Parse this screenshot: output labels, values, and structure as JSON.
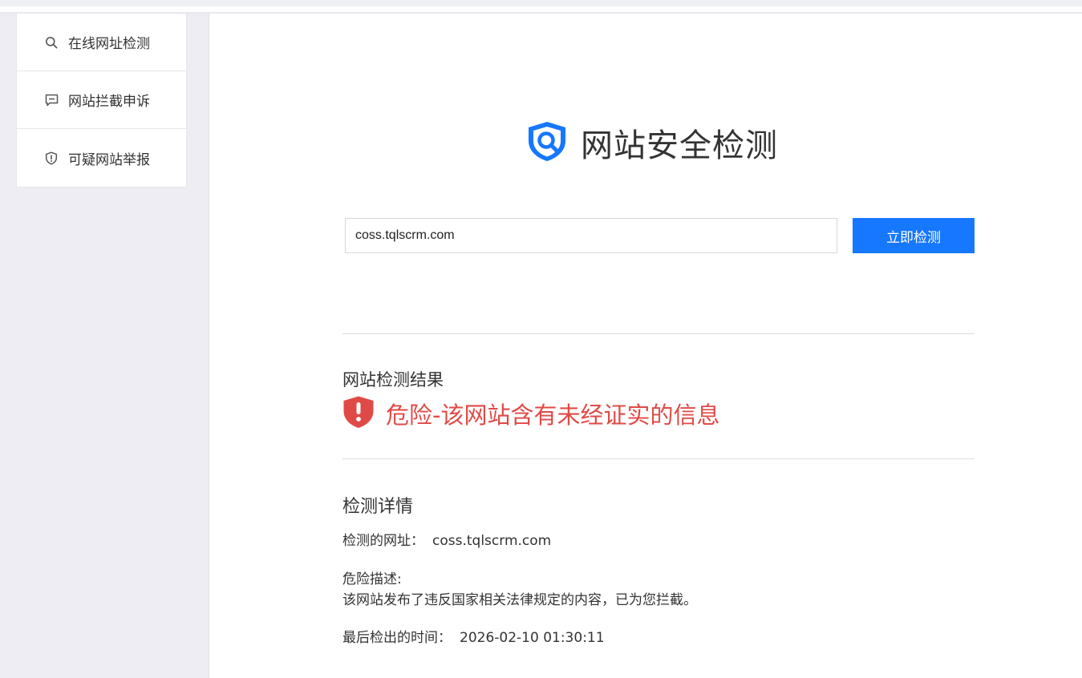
{
  "sidebar": {
    "items": [
      {
        "label": "在线网址检测",
        "icon": "search-icon"
      },
      {
        "label": "网站拦截申诉",
        "icon": "message-icon"
      },
      {
        "label": "可疑网站举报",
        "icon": "shield-alert-icon"
      }
    ]
  },
  "logo": {
    "title": "网站安全检测",
    "icon": "shield-search-icon"
  },
  "search": {
    "value": "coss.tqlscrm.com",
    "button_label": "立即检测"
  },
  "result": {
    "heading": "网站检测结果",
    "status": "危险-该网站含有未经证实的信息",
    "status_icon": "danger-shield-icon"
  },
  "details": {
    "heading": "检测详情",
    "url_label": "检测的网址：",
    "url_value": "coss.tqlscrm.com",
    "risk_label": "危险描述:",
    "risk_text": "该网站发布了违反国家相关法律规定的内容，已为您拦截。",
    "time_label": "最后检出的时间：",
    "time_value": "2026-02-10 01:30:11"
  },
  "colors": {
    "accent": "#1677ff",
    "danger": "#e04a46",
    "sidebar_bg": "#eeedf3"
  }
}
